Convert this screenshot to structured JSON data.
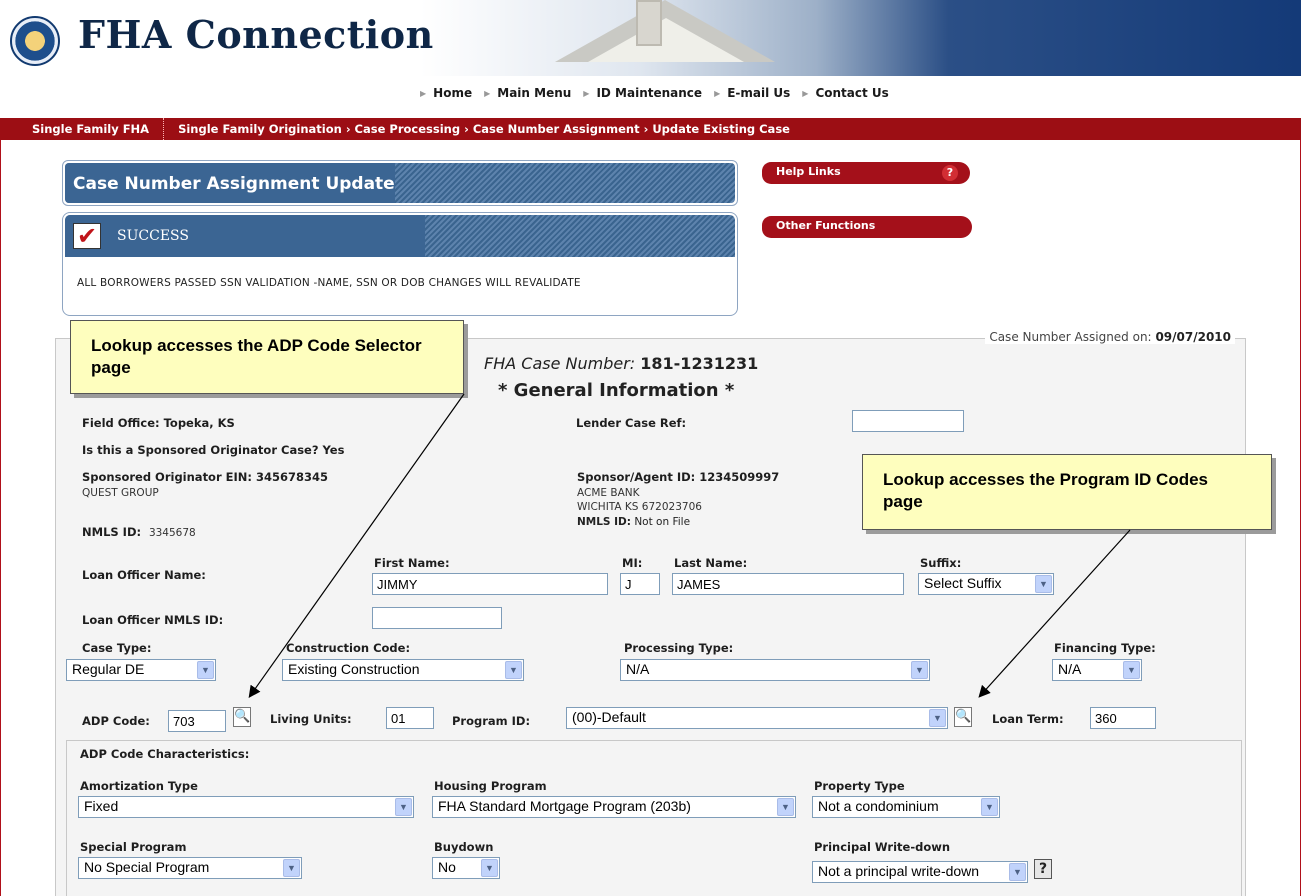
{
  "header": {
    "logo_text": "FHA Connection",
    "nav": [
      "Home",
      "Main Menu",
      "ID Maintenance",
      "E-mail Us",
      "Contact Us"
    ],
    "breadcrumb_root": "Single Family FHA",
    "breadcrumb_path": "Single Family Origination › Case Processing › Case Number Assignment › Update Existing Case"
  },
  "title": "Case Number Assignment Update",
  "success": {
    "label": "SUCCESS",
    "message": "ALL BORROWERS PASSED SSN VALIDATION -NAME, SSN OR DOB CHANGES WILL REVALIDATE"
  },
  "side_links": {
    "help": "Help Links",
    "help_icon": "?",
    "other": "Other Functions"
  },
  "assigned": {
    "label": "Case Number Assigned on:",
    "date": "09/07/2010"
  },
  "case": {
    "label": "FHA Case Number:",
    "number": "181-1231231",
    "section": "* General Information *"
  },
  "field_office": "Field Office:  Topeka, KS",
  "sponsored_question": "Is this a Sponsored Originator Case? Yes",
  "sponsored_ein": "Sponsored Originator EIN:  345678345",
  "sponsored_name": "QUEST GROUP",
  "nmls_left_label": "NMLS ID:",
  "nmls_left_value": "3345678",
  "lender_case_ref_label": "Lender Case Ref:",
  "lender_case_ref_value": "",
  "sponsor": {
    "label": "Sponsor/Agent ID:  1234509997",
    "line1": "ACME BANK",
    "line2": "WICHITA KS 672023706",
    "nmls_label": "NMLS ID:",
    "nmls_value": "Not on File"
  },
  "loan_officer": {
    "label": "Loan Officer Name:",
    "first_label": "First Name:",
    "first": "JIMMY",
    "mi_label": "MI:",
    "mi": "J",
    "last_label": "Last Name:",
    "last": "JAMES",
    "suffix_label": "Suffix:",
    "suffix": "Select Suffix",
    "nmls_label": "Loan Officer NMLS ID:",
    "nmls": ""
  },
  "case_type": {
    "label": "Case Type:",
    "value": "Regular DE"
  },
  "construction": {
    "label": "Construction Code:",
    "value": "Existing Construction"
  },
  "processing": {
    "label": "Processing Type:",
    "value": "N/A"
  },
  "financing": {
    "label": "Financing Type:",
    "value": "N/A"
  },
  "adp": {
    "label": "ADP Code:",
    "value": "703"
  },
  "living_units": {
    "label": "Living Units:",
    "value": "01"
  },
  "program_id": {
    "label": "Program ID:",
    "value": "(00)-Default"
  },
  "loan_term": {
    "label": "Loan Term:",
    "value": "360"
  },
  "adp_chars": {
    "heading": "ADP Code Characteristics:",
    "amort_label": "Amortization Type",
    "amort": "Fixed",
    "housing_label": "Housing Program",
    "housing": "FHA Standard Mortgage Program (203b)",
    "property_label": "Property Type",
    "property": "Not a condominium",
    "special_label": "Special Program",
    "special": "No Special Program",
    "buydown_label": "Buydown",
    "buydown": "No",
    "writedown_label": "Principal Write-down",
    "writedown": "Not a principal write-down",
    "help_icon": "?"
  },
  "callouts": {
    "adp": "Lookup accesses the ADP Code Selector page",
    "program": "Lookup accesses the Program ID Codes page"
  }
}
